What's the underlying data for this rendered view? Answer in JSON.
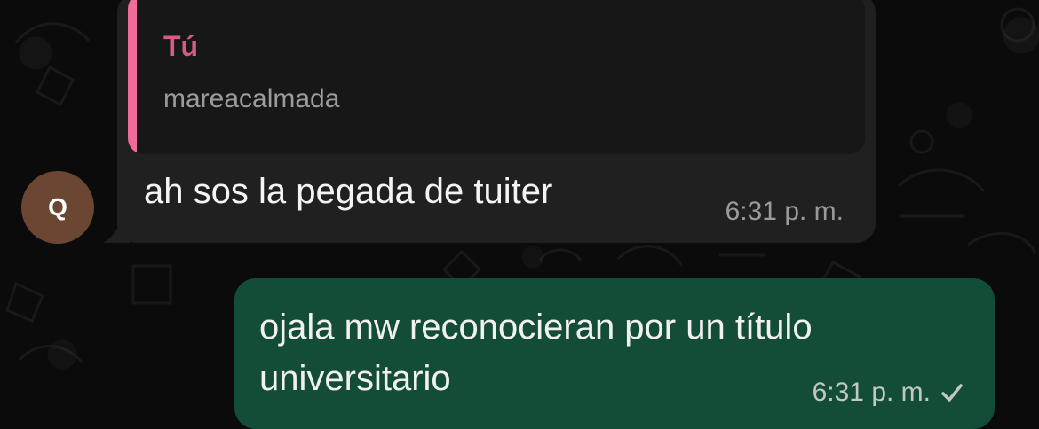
{
  "messages": {
    "incoming": {
      "quote_author": "Tú",
      "quote_text": "mareacalmada",
      "text": "ah sos la pegada de tuiter",
      "time": "6:31 p. m."
    },
    "outgoing": {
      "text": "ojala mw reconocieran por un título universitario",
      "time": "6:31 p. m."
    }
  },
  "avatar": {
    "initial": "Q"
  },
  "icons": {
    "status": "checkmark-icon"
  },
  "colors": {
    "background": "#0b0b0b",
    "incoming_bubble": "#202020",
    "quoted_panel": "#171717",
    "quote_accent": "#f06b9a",
    "outgoing_bubble": "#144d37"
  }
}
